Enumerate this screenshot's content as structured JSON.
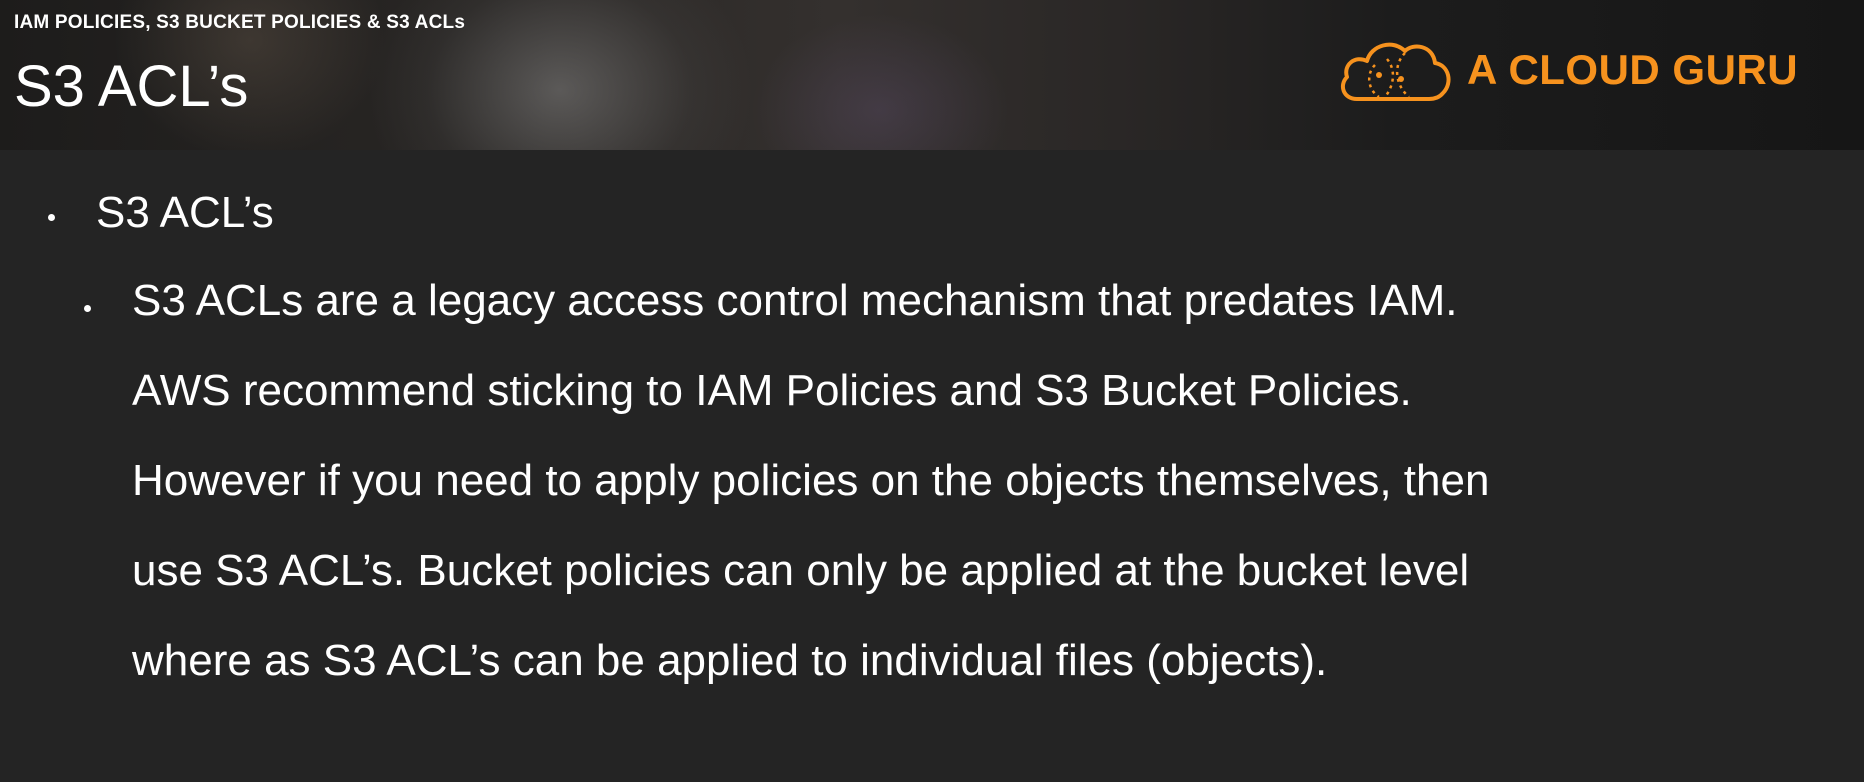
{
  "header": {
    "subtitle": "IAM POLICIES, S3 BUCKET POLICIES & S3 ACLs",
    "title": "S3 ACL’s"
  },
  "logo": {
    "text": "A CLOUD GURU",
    "icon": "cloud-icon",
    "color": "#f6921e"
  },
  "content": {
    "bullet": "S3 ACL’s",
    "sub_bullet_lines": [
      "S3 ACLs are a legacy access control mechanism that predates IAM.",
      "AWS recommend sticking to IAM Policies and S3 Bucket Policies.",
      "However if you need to apply policies on the objects themselves, then",
      "use S3 ACL’s. Bucket policies can only be applied at the bucket level",
      "where as S3 ACL’s can be applied to individual files (objects)."
    ]
  }
}
